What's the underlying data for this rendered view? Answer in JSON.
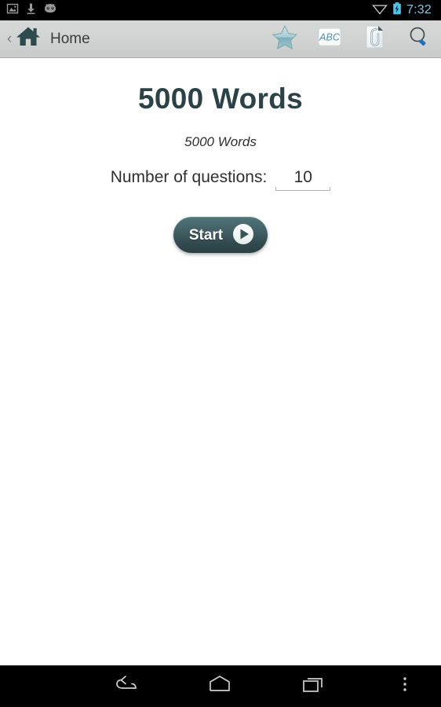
{
  "status_bar": {
    "icons": [
      "gallery-image-icon",
      "download-icon",
      "cyanogenmod-robot-icon"
    ],
    "wifi_icon": "wifi-icon",
    "battery_icon": "battery-charging-icon",
    "clock": "7:32",
    "clock_color": "#7fc8e8",
    "background": "#000000"
  },
  "action_bar": {
    "back_chevron": "‹",
    "home_icon": "home-icon",
    "title": "Home",
    "actions": [
      {
        "name": "favorites-star-icon",
        "label": "Favorites"
      },
      {
        "name": "abc-card-icon",
        "label": "ABC"
      },
      {
        "name": "attachment-document-icon",
        "label": "Attachments"
      },
      {
        "name": "search-icon",
        "label": "Search"
      }
    ],
    "background_top": "#d6d8d7",
    "background_bottom": "#c9cbca"
  },
  "main": {
    "title": "5000 Words",
    "subtitle": "5000 Words",
    "question_label": "Number of questions:",
    "question_count": "10",
    "question_placeholder": "10",
    "start_label": "Start",
    "start_icon": "play-icon",
    "title_color": "#2b4347",
    "button_color": "#3c5a5f"
  },
  "nav_bar": {
    "back": "back-icon",
    "home": "home-icon",
    "recents": "recent-apps-icon",
    "menu": "overflow-menu-icon",
    "background": "#000000"
  }
}
